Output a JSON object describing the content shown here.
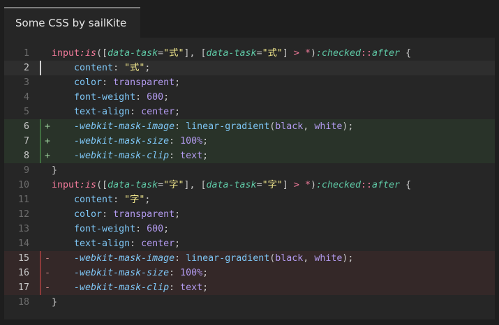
{
  "tab": {
    "title": "Some CSS by sailKite"
  },
  "colors": {
    "background": "#1e1e1e",
    "editor_bg": "#262626",
    "added_line_bg": "#293329",
    "removed_line_bg": "#342828",
    "current_line_bg": "#2e2e2e"
  },
  "lines": [
    {
      "n": "1",
      "state": "normal",
      "sign": "",
      "tokens": [
        [
          "t-sel",
          "input"
        ],
        [
          "t-fn",
          ":is"
        ],
        [
          "t-punc",
          "(["
        ],
        [
          "t-attr",
          "data-task"
        ],
        [
          "t-punc",
          "="
        ],
        [
          "t-str",
          "\"式\""
        ],
        [
          "t-punc",
          "], ["
        ],
        [
          "t-attr",
          "data-task"
        ],
        [
          "t-punc",
          "="
        ],
        [
          "t-str",
          "\"式\""
        ],
        [
          "t-punc",
          "] "
        ],
        [
          "t-op",
          ">"
        ],
        [
          "t-punc",
          " "
        ],
        [
          "t-op",
          "*"
        ],
        [
          "t-punc",
          ")"
        ],
        [
          "t-pseudo",
          ":checked"
        ],
        [
          "t-op",
          "::"
        ],
        [
          "t-pseudo",
          "after"
        ],
        [
          "t-punc",
          " {"
        ]
      ]
    },
    {
      "n": "2",
      "state": "current",
      "sign": "",
      "tokens": [
        [
          "t-plain",
          "    "
        ],
        [
          "t-prop",
          "content"
        ],
        [
          "t-punc",
          ": "
        ],
        [
          "t-str",
          "\"式\""
        ],
        [
          "t-punc",
          ";"
        ]
      ]
    },
    {
      "n": "3",
      "state": "normal",
      "sign": "",
      "tokens": [
        [
          "t-plain",
          "    "
        ],
        [
          "t-prop",
          "color"
        ],
        [
          "t-punc",
          ": "
        ],
        [
          "t-val",
          "transparent"
        ],
        [
          "t-punc",
          ";"
        ]
      ]
    },
    {
      "n": "4",
      "state": "normal",
      "sign": "",
      "tokens": [
        [
          "t-plain",
          "    "
        ],
        [
          "t-prop",
          "font-weight"
        ],
        [
          "t-punc",
          ": "
        ],
        [
          "t-num",
          "600"
        ],
        [
          "t-punc",
          ";"
        ]
      ]
    },
    {
      "n": "5",
      "state": "normal",
      "sign": "",
      "tokens": [
        [
          "t-plain",
          "    "
        ],
        [
          "t-prop",
          "text-align"
        ],
        [
          "t-punc",
          ": "
        ],
        [
          "t-val",
          "center"
        ],
        [
          "t-punc",
          ";"
        ]
      ]
    },
    {
      "n": "6",
      "state": "added",
      "sign": "+",
      "tokens": [
        [
          "t-plain",
          "    "
        ],
        [
          "t-vprop",
          "-webkit-mask-image"
        ],
        [
          "t-punc",
          ": "
        ],
        [
          "t-prop",
          "linear-gradient"
        ],
        [
          "t-punc",
          "("
        ],
        [
          "t-val",
          "black"
        ],
        [
          "t-punc",
          ", "
        ],
        [
          "t-val",
          "white"
        ],
        [
          "t-punc",
          ");"
        ]
      ]
    },
    {
      "n": "7",
      "state": "added",
      "sign": "+",
      "tokens": [
        [
          "t-plain",
          "    "
        ],
        [
          "t-vprop",
          "-webkit-mask-size"
        ],
        [
          "t-punc",
          ": "
        ],
        [
          "t-num",
          "100%"
        ],
        [
          "t-punc",
          ";"
        ]
      ]
    },
    {
      "n": "8",
      "state": "added",
      "sign": "+",
      "tokens": [
        [
          "t-plain",
          "    "
        ],
        [
          "t-vprop",
          "-webkit-mask-clip"
        ],
        [
          "t-punc",
          ": "
        ],
        [
          "t-val",
          "text"
        ],
        [
          "t-punc",
          ";"
        ]
      ]
    },
    {
      "n": "9",
      "state": "normal",
      "sign": "",
      "tokens": [
        [
          "t-punc",
          "}"
        ]
      ]
    },
    {
      "n": "10",
      "state": "normal",
      "sign": "",
      "tokens": [
        [
          "t-sel",
          "input"
        ],
        [
          "t-fn",
          ":is"
        ],
        [
          "t-punc",
          "(["
        ],
        [
          "t-attr",
          "data-task"
        ],
        [
          "t-punc",
          "="
        ],
        [
          "t-str",
          "\"字\""
        ],
        [
          "t-punc",
          "], ["
        ],
        [
          "t-attr",
          "data-task"
        ],
        [
          "t-punc",
          "="
        ],
        [
          "t-str",
          "\"字\""
        ],
        [
          "t-punc",
          "] "
        ],
        [
          "t-op",
          ">"
        ],
        [
          "t-punc",
          " "
        ],
        [
          "t-op",
          "*"
        ],
        [
          "t-punc",
          ")"
        ],
        [
          "t-pseudo",
          ":checked"
        ],
        [
          "t-op",
          "::"
        ],
        [
          "t-pseudo",
          "after"
        ],
        [
          "t-punc",
          " {"
        ]
      ]
    },
    {
      "n": "11",
      "state": "normal",
      "sign": "",
      "tokens": [
        [
          "t-plain",
          "    "
        ],
        [
          "t-prop",
          "content"
        ],
        [
          "t-punc",
          ": "
        ],
        [
          "t-str",
          "\"字\""
        ],
        [
          "t-punc",
          ";"
        ]
      ]
    },
    {
      "n": "12",
      "state": "normal",
      "sign": "",
      "tokens": [
        [
          "t-plain",
          "    "
        ],
        [
          "t-prop",
          "color"
        ],
        [
          "t-punc",
          ": "
        ],
        [
          "t-val",
          "transparent"
        ],
        [
          "t-punc",
          ";"
        ]
      ]
    },
    {
      "n": "13",
      "state": "normal",
      "sign": "",
      "tokens": [
        [
          "t-plain",
          "    "
        ],
        [
          "t-prop",
          "font-weight"
        ],
        [
          "t-punc",
          ": "
        ],
        [
          "t-num",
          "600"
        ],
        [
          "t-punc",
          ";"
        ]
      ]
    },
    {
      "n": "14",
      "state": "normal",
      "sign": "",
      "tokens": [
        [
          "t-plain",
          "    "
        ],
        [
          "t-prop",
          "text-align"
        ],
        [
          "t-punc",
          ": "
        ],
        [
          "t-val",
          "center"
        ],
        [
          "t-punc",
          ";"
        ]
      ]
    },
    {
      "n": "15",
      "state": "removed",
      "sign": "-",
      "tokens": [
        [
          "t-plain",
          "    "
        ],
        [
          "t-vprop",
          "-webkit-mask-image"
        ],
        [
          "t-punc",
          ": "
        ],
        [
          "t-prop",
          "linear-gradient"
        ],
        [
          "t-punc",
          "("
        ],
        [
          "t-val",
          "black"
        ],
        [
          "t-punc",
          ", "
        ],
        [
          "t-val",
          "white"
        ],
        [
          "t-punc",
          ");"
        ]
      ]
    },
    {
      "n": "16",
      "state": "removed",
      "sign": "-",
      "tokens": [
        [
          "t-plain",
          "    "
        ],
        [
          "t-vprop",
          "-webkit-mask-size"
        ],
        [
          "t-punc",
          ": "
        ],
        [
          "t-num",
          "100%"
        ],
        [
          "t-punc",
          ";"
        ]
      ]
    },
    {
      "n": "17",
      "state": "removed",
      "sign": "-",
      "tokens": [
        [
          "t-plain",
          "    "
        ],
        [
          "t-vprop",
          "-webkit-mask-clip"
        ],
        [
          "t-punc",
          ": "
        ],
        [
          "t-val",
          "text"
        ],
        [
          "t-punc",
          ";"
        ]
      ]
    },
    {
      "n": "18",
      "state": "normal",
      "sign": "",
      "tokens": [
        [
          "t-punc",
          "}"
        ]
      ]
    }
  ]
}
